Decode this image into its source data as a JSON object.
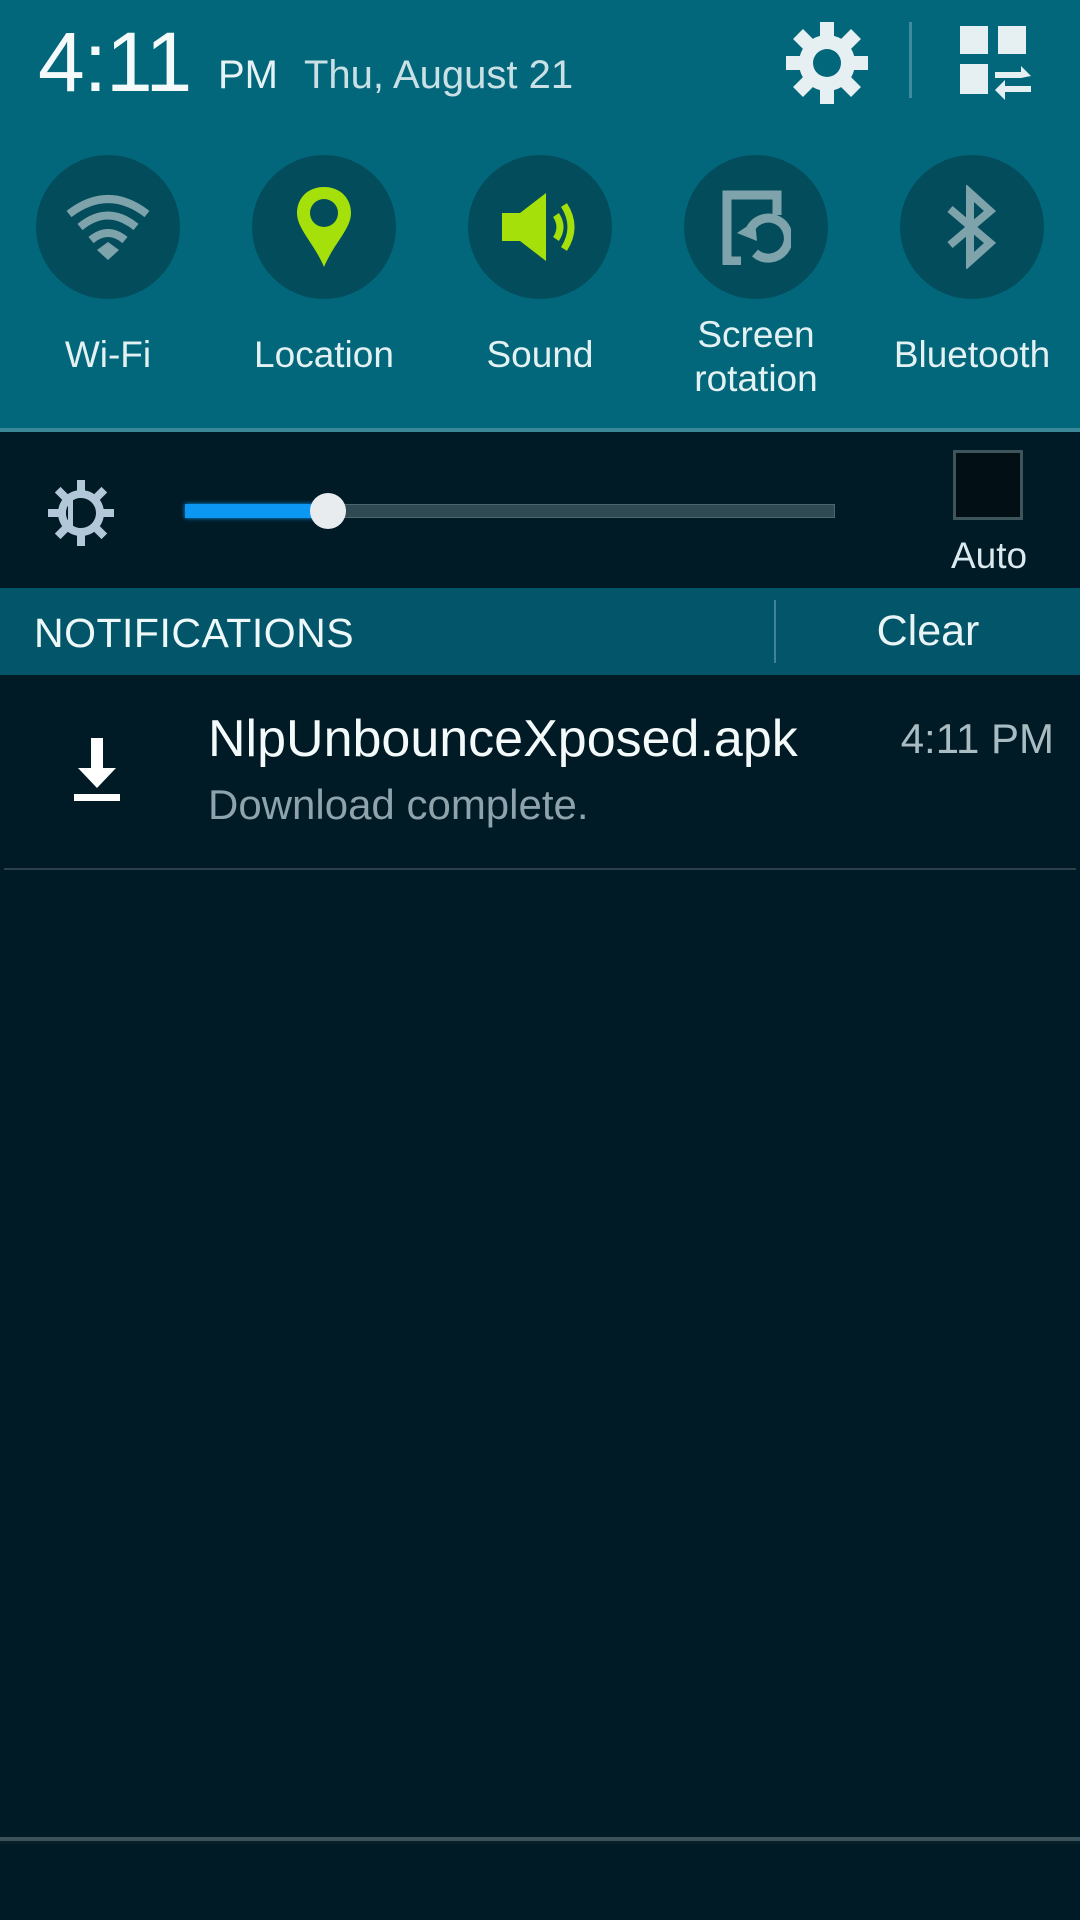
{
  "status_header": {
    "time": "4:11",
    "ampm": "PM",
    "date": "Thu, August 21",
    "settings_icon": "gear-icon",
    "quick_settings_icon": "grid-swap-icon"
  },
  "quick_toggles": [
    {
      "label": "Wi-Fi",
      "icon": "wifi-icon",
      "active": false
    },
    {
      "label": "Location",
      "icon": "location-pin-icon",
      "active": true
    },
    {
      "label": "Sound",
      "icon": "speaker-icon",
      "active": true
    },
    {
      "label_line1": "Screen",
      "label_line2": "rotation",
      "icon": "screen-rotation-icon",
      "active": false
    },
    {
      "label": "Bluetooth",
      "icon": "bluetooth-icon",
      "active": false
    }
  ],
  "brightness": {
    "icon": "brightness-icon",
    "value": 0.22,
    "auto_label": "Auto",
    "auto_checked": false
  },
  "notifications": {
    "header": "NOTIFICATIONS",
    "clear_label": "Clear",
    "items": [
      {
        "icon": "download-icon",
        "title": "NlpUnbounceXposed.apk",
        "subtitle": "Download complete.",
        "time": "4:11 PM"
      }
    ]
  },
  "colors": {
    "active_icon": "#a6e00a",
    "inactive_icon": "#7ea3ab",
    "slider_fill": "#0c97f2"
  }
}
